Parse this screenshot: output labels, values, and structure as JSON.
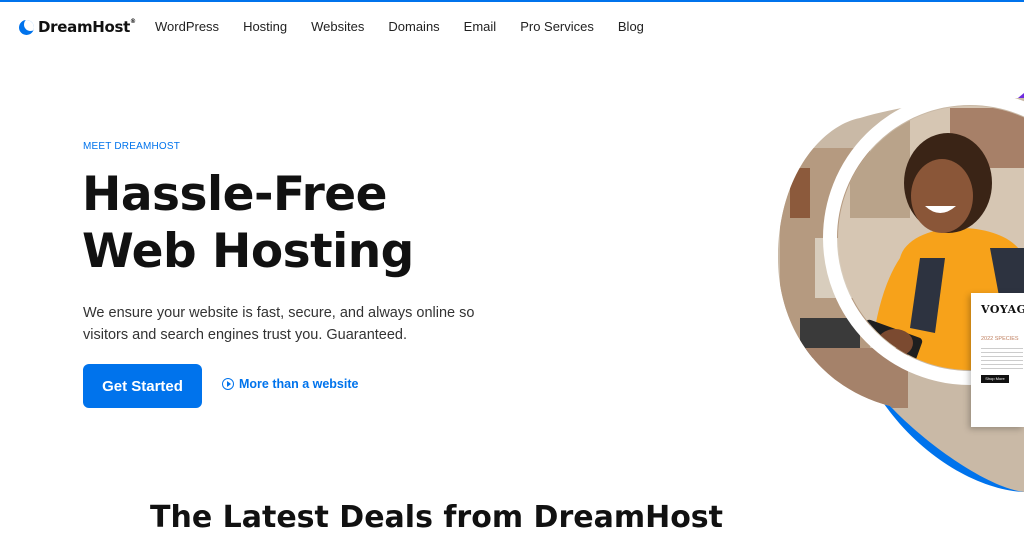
{
  "brand": {
    "name": "DreamHost",
    "reg": "®",
    "color": "#0073ec"
  },
  "nav": {
    "items": [
      "WordPress",
      "Hosting",
      "Websites",
      "Domains",
      "Email",
      "Pro Services",
      "Blog"
    ]
  },
  "hero": {
    "eyebrow": "MEET DREAMHOST",
    "headline_line1": "Hassle-Free",
    "headline_line2": "Web Hosting",
    "subtitle": "We ensure your website is fast, secure, and always online so visitors and search engines trust you. Guaranteed.",
    "cta_label": "Get Started",
    "video_link_label": "More than a website"
  },
  "voyage_card": {
    "title": "VOYAGE",
    "subtitle": "2022 SPECIES",
    "button": "Shop More"
  },
  "next_section": {
    "heading": "The Latest Deals from DreamHost"
  },
  "colors": {
    "accent": "#0073ec",
    "purple": "#6f2bde",
    "orange": "#f7a21a"
  }
}
